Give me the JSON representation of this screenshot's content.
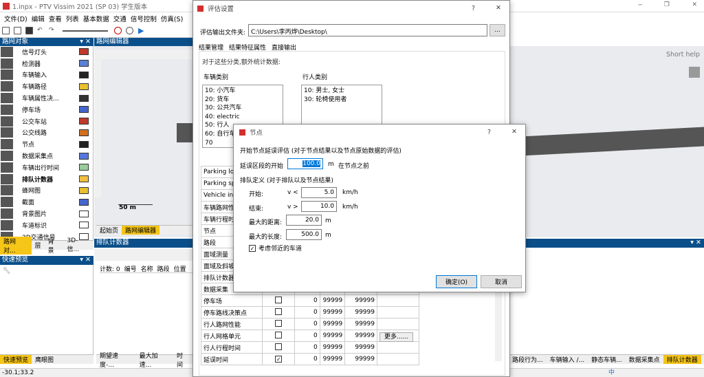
{
  "app_title": "1.inpx - PTV Vissim 2021 (SP 03) 学生版本",
  "menu": [
    "文件(D)",
    "编辑",
    "查看",
    "列表",
    "基本数据",
    "交通",
    "信号控制",
    "仿真(S)"
  ],
  "network_objects": {
    "title": "路网对象",
    "items": [
      {
        "label": "信号灯头",
        "color": "#c0392b"
      },
      {
        "label": "检测器",
        "color": "#5a7fd6"
      },
      {
        "label": "车辆输入",
        "color": "#222222"
      },
      {
        "label": "车辆路径",
        "color": "#e8c030"
      },
      {
        "label": "车辆属性决...",
        "color": "#333333"
      },
      {
        "label": "停车场",
        "color": "#4466cc"
      },
      {
        "label": "公交车站",
        "color": "#c0392b"
      },
      {
        "label": "公交线路",
        "color": "#d07020"
      },
      {
        "label": "节点",
        "color": "#222222"
      },
      {
        "label": "数据采集点",
        "color": "#5577dd"
      },
      {
        "label": "车辆出行时间",
        "color": "#99cc99"
      },
      {
        "label": "排队计数器",
        "color": "#f0c040"
      },
      {
        "label": "蜂网图",
        "color": "#e8c030"
      },
      {
        "label": "截面",
        "color": "#4466cc"
      },
      {
        "label": "背景图片",
        "color": "#ffffff"
      },
      {
        "label": "车道标识",
        "color": "#ffffff"
      },
      {
        "label": "3D交通信号",
        "color": "#ffffff"
      }
    ]
  },
  "left_tabs": [
    "路网对...",
    "层",
    "背景",
    "3D-信..."
  ],
  "quick_view": {
    "title": "快速预览"
  },
  "bottom_left_tabs": [
    "快速预览",
    "鹰眼图"
  ],
  "network_editor": {
    "title": "路网编辑器",
    "scale": "50 m",
    "short_help": "Short help"
  },
  "editor_tabs": [
    "起始页",
    "路网编辑器"
  ],
  "queue_counter": {
    "title": "排队计数器",
    "columns": [
      "计数: 0",
      "编号",
      "名称",
      "路段",
      "位置"
    ]
  },
  "bottom_tabs_mid": [
    "期望速度-...",
    "最大加速...",
    "时间"
  ],
  "bottom_tabs_right": [
    "路段行为...",
    "车辆输入 /...",
    "静态车辆...",
    "数据采集点",
    "排队计数器"
  ],
  "status": "-30.1;33.2",
  "ime": "中",
  "eval_dialog": {
    "title": "评估设置",
    "help": "?",
    "output_folder_label": "评估输出文件夹:",
    "output_folder": "C:\\Users\\李丙烨\\Desktop\\",
    "browse": "...",
    "tabs": [
      "结果管理",
      "结果特征属性",
      "直接输出"
    ],
    "note": "对于这些分类,额外统计数据:",
    "vehicle_class_label": "车辆类别",
    "vehicle_classes": [
      "10: 小汽车",
      "20: 货车",
      "30: 公共汽车",
      "40: electric",
      "50: 行人",
      "60: 自行车",
      "70"
    ],
    "ped_class_label": "行人类别",
    "ped_classes": [
      "10: 男士, 女士",
      "30: 轮椅使用者"
    ],
    "rows": [
      {
        "name": "Parking lo",
        "chk": null,
        "a": "",
        "b": "",
        "c": ""
      },
      {
        "name": "Parking sp",
        "chk": null,
        "a": "",
        "b": "",
        "c": ""
      },
      {
        "name": "Vehicle inp",
        "chk": null,
        "a": "",
        "b": "",
        "c": ""
      },
      {
        "name": "车辆路网性能",
        "chk": null,
        "a": "",
        "b": "",
        "c": ""
      },
      {
        "name": "车辆行程时",
        "chk": null,
        "a": "",
        "b": "",
        "c": ""
      },
      {
        "name": "节点",
        "chk": null,
        "a": "",
        "b": "",
        "c": ""
      },
      {
        "name": "路段",
        "chk": null,
        "a": "",
        "b": "",
        "c": ""
      },
      {
        "name": "面域测量",
        "chk": null,
        "a": "",
        "b": "",
        "c": ""
      },
      {
        "name": "面域及斜坡",
        "chk": null,
        "a": "",
        "b": "",
        "c": ""
      },
      {
        "name": "排队计数器",
        "chk": null,
        "a": "",
        "b": "",
        "c": ""
      },
      {
        "name": "数据采集",
        "chk": null,
        "a": "",
        "b": "",
        "c": ""
      },
      {
        "name": "停车场",
        "chk": false,
        "a": "0",
        "b": "99999",
        "c": "99999"
      },
      {
        "name": "停车路线决策点",
        "chk": false,
        "a": "0",
        "b": "99999",
        "c": "99999"
      },
      {
        "name": "行人路网性能",
        "chk": false,
        "a": "0",
        "b": "99999",
        "c": "99999"
      },
      {
        "name": "行人网格单元",
        "chk": false,
        "a": "0",
        "b": "99999",
        "c": "99999"
      },
      {
        "name": "行人行程时间",
        "chk": false,
        "a": "0",
        "b": "99999",
        "c": "99999"
      },
      {
        "name": "延误时间",
        "chk": true,
        "a": "0",
        "b": "99999",
        "c": "99999"
      }
    ],
    "more": "更多......"
  },
  "node_dialog": {
    "title": "节点",
    "help": "?",
    "heading": "开始节点延误评估 (对于节点结果以及节点原始数据的评估)",
    "delay_start_label": "延误区段的开始",
    "delay_start_value": "100.0",
    "delay_start_unit": "m",
    "delay_start_suffix": "在节点之前",
    "queue_def": "排队定义 (对于排队以及节点结果)",
    "begin_label": "开始:",
    "begin_cond": "v <",
    "begin_value": "5.0",
    "begin_unit": "km/h",
    "end_label": "结束:",
    "end_cond": "v >",
    "end_value": "10.0",
    "end_unit": "km/h",
    "max_dist_label": "最大的距离:",
    "max_dist_value": "20.0",
    "max_dist_unit": "m",
    "max_len_label": "最大的长度:",
    "max_len_value": "500.0",
    "max_len_unit": "m",
    "adjacent_label": "考虑邻近的车道",
    "adjacent_checked": true,
    "ok": "确定(O)",
    "cancel": "取消"
  }
}
